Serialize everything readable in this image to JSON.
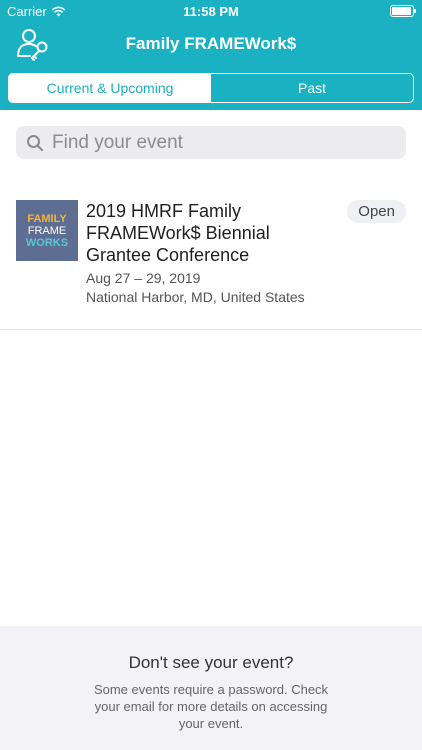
{
  "status_bar": {
    "carrier": "Carrier",
    "time": "11:58 PM"
  },
  "nav": {
    "title": "Family FRAMEWork$",
    "left_icon": "user-key-icon"
  },
  "tabs": [
    {
      "label": "Current & Upcoming",
      "active": true
    },
    {
      "label": "Past",
      "active": false
    }
  ],
  "search": {
    "placeholder": "Find your event",
    "value": ""
  },
  "events": [
    {
      "logo_lines": [
        "FAMILY",
        "FRAME",
        "WORKS"
      ],
      "title": "2019 HMRF Family FRAMEWork$ Biennial Grantee Conference",
      "dates": "Aug 27 – 29, 2019",
      "location": "National Harbor, MD, United States",
      "status": "Open"
    }
  ],
  "footer": {
    "title": "Don't see your event?",
    "body": "Some events require a password. Check your email for more details on accessing your event."
  },
  "colors": {
    "accent": "#1ab1c2",
    "logo_bg": "#5e6d92"
  }
}
